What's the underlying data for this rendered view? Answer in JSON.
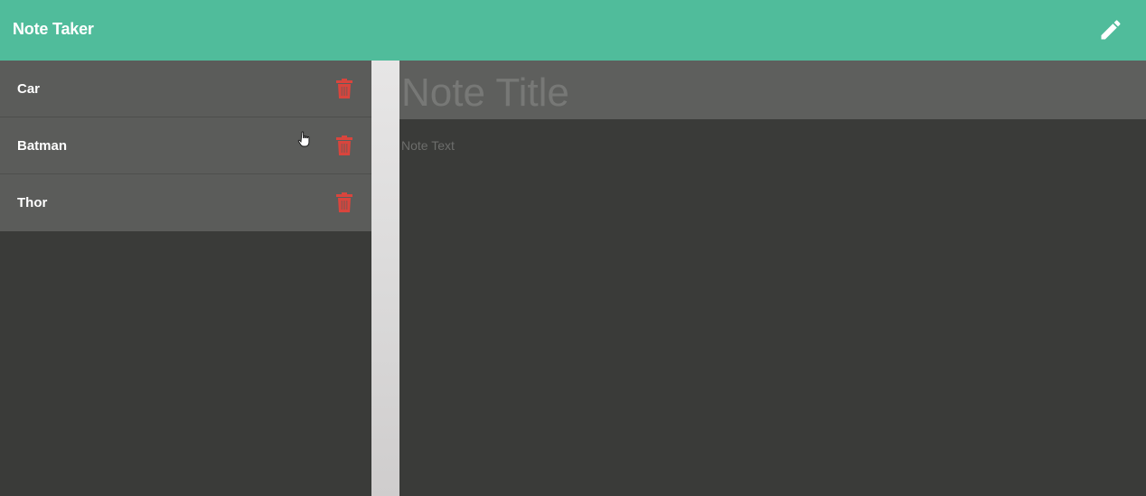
{
  "header": {
    "title": "Note Taker",
    "new_note_icon": "pencil-icon"
  },
  "notes": [
    {
      "label": "Car",
      "delete_icon": "trash-icon"
    },
    {
      "label": "Batman",
      "delete_icon": "trash-icon"
    },
    {
      "label": "Thor",
      "delete_icon": "trash-icon"
    }
  ],
  "editor": {
    "title_placeholder": "Note Title",
    "text_placeholder": "Note Text"
  },
  "colors": {
    "navbar": "#50bc9b",
    "list_item": "#5b5c5a",
    "background": "#3a3b39",
    "delete": "#d9453d"
  }
}
